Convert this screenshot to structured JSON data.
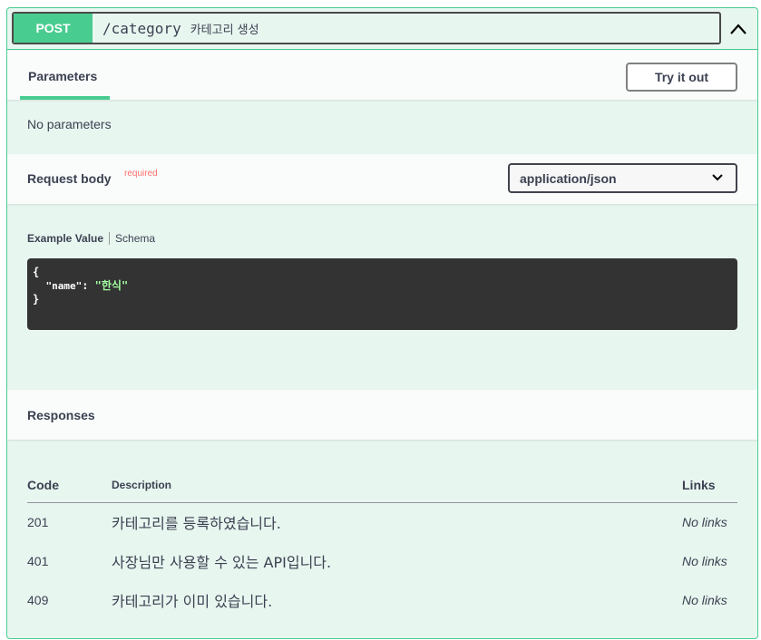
{
  "operation": {
    "method": "POST",
    "path": "/category",
    "summary": "카테고리 생성"
  },
  "parameters": {
    "tab_label": "Parameters",
    "try_button": "Try it out",
    "empty_text": "No parameters"
  },
  "request_body": {
    "title": "Request body",
    "required_flag": "required",
    "content_type": "application/json",
    "tabs": {
      "example": "Example Value",
      "schema": "Schema"
    },
    "example": {
      "open": "{",
      "key": "\"name\"",
      "colon": ": ",
      "value": "\"한식\"",
      "close": "}"
    }
  },
  "responses": {
    "title": "Responses",
    "headers": {
      "code": "Code",
      "description": "Description",
      "links": "Links"
    },
    "rows": [
      {
        "code": "201",
        "description": "카테고리를 등록하였습니다.",
        "links": "No links"
      },
      {
        "code": "401",
        "description": "사장님만 사용할 수 있는 API입니다.",
        "links": "No links"
      },
      {
        "code": "409",
        "description": "카테고리가 이미 있습니다.",
        "links": "No links"
      }
    ]
  },
  "colors": {
    "post_accent": "#49cc90",
    "block_background": "#e8f6f0",
    "required_red": "#ff6f6f",
    "code_background": "#333333"
  },
  "icons": {
    "collapse": "chevron-up-icon",
    "select": "chevron-down-icon"
  }
}
